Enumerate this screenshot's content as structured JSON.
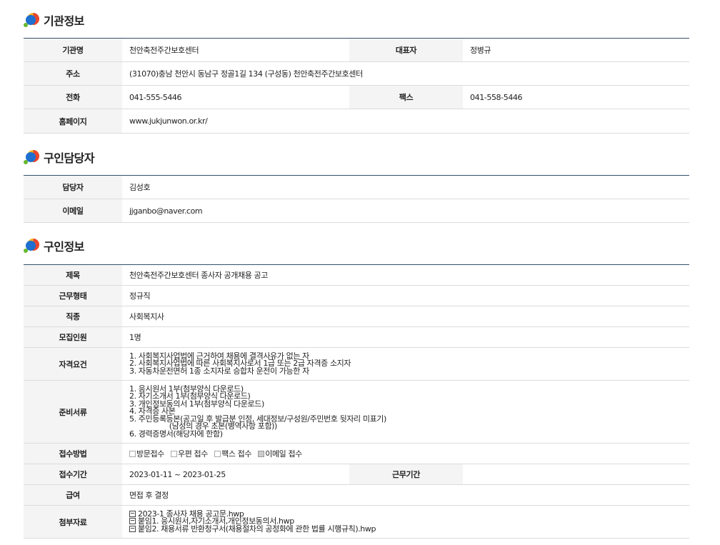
{
  "org_section": {
    "title": "기관정보",
    "rows": {
      "name_label": "기관명",
      "name": "천안축전주간보호센터",
      "rep_label": "대표자",
      "rep": "정병규",
      "addr_label": "주소",
      "addr": "(31070)충남 천안시 동남구 정골1길 134 (구성동) 천안축전주간보호센터",
      "phone_label": "전화",
      "phone": "041-555-5446",
      "fax_label": "팩스",
      "fax": "041-558-5446",
      "home_label": "홈페이지",
      "home": "www.jukjunwon.or.kr/"
    }
  },
  "contact_section": {
    "title": "구인담당자",
    "manager_label": "담당자",
    "manager": "김성호",
    "email_label": "이메일",
    "email": "jjganbo@naver.com"
  },
  "job_section": {
    "title": "구인정보",
    "subject_label": "제목",
    "subject": "천안축전주간보호센터 종사자 공개채용 공고",
    "worktype_label": "근무형태",
    "worktype": "정규직",
    "jobtype_label": "직종",
    "jobtype": "사회복지사",
    "headcount_label": "모집인원",
    "headcount": "1명",
    "qual_label": "자격요건",
    "qual_lines": [
      "1. 사회복지사업법에 근거하여 채용에 결격사유가 없는 자",
      "2. 사회복지사업법에 따른 사회복지사로서 1급 또는 2급 자격증 소지자",
      "3. 자동차운전면허 1종 소지자로 승합차 운전이 가능한 자"
    ],
    "docs_label": "준비서류",
    "docs_lines": [
      "1. 응시원서 1부(첨부양식 다운로드)",
      "2. 자기소개서 1부(첨부양식 다운로드)",
      "3. 개인정보동의서 1부(첨부양식 다운로드)",
      "4. 자격증 사본",
      "5. 주민등록등본(공고일 후 발급분 인정, 세대정보/구성원/주민번호 뒷자리 미표기)",
      "                  (남성의 경우 초본(병역사항 포함))",
      "6. 경력증명서(해당자에 한함)"
    ],
    "method_label": "접수방법",
    "methods": [
      {
        "label": "방문접수",
        "checked": false
      },
      {
        "label": "우편 접수",
        "checked": false
      },
      {
        "label": "팩스 접수",
        "checked": false
      },
      {
        "label": "이메일 접수",
        "checked": true
      }
    ],
    "period_label": "접수기간",
    "period": "2023-01-11 ~ 2023-01-25",
    "workperiod_label": "근무기간",
    "workperiod": "",
    "pay_label": "급여",
    "pay": "면접 후 결정",
    "attach_label": "첨부자료",
    "attachments": [
      "2023-1 종사자 채용 공고문.hwp",
      "붙임1. 응시원서,자기소개서,개인정보동의서.hwp",
      "붙임2. 채용서류 반환청구서(채용절차의 공정화에 관한 법률 시행규칙).hwp"
    ]
  }
}
